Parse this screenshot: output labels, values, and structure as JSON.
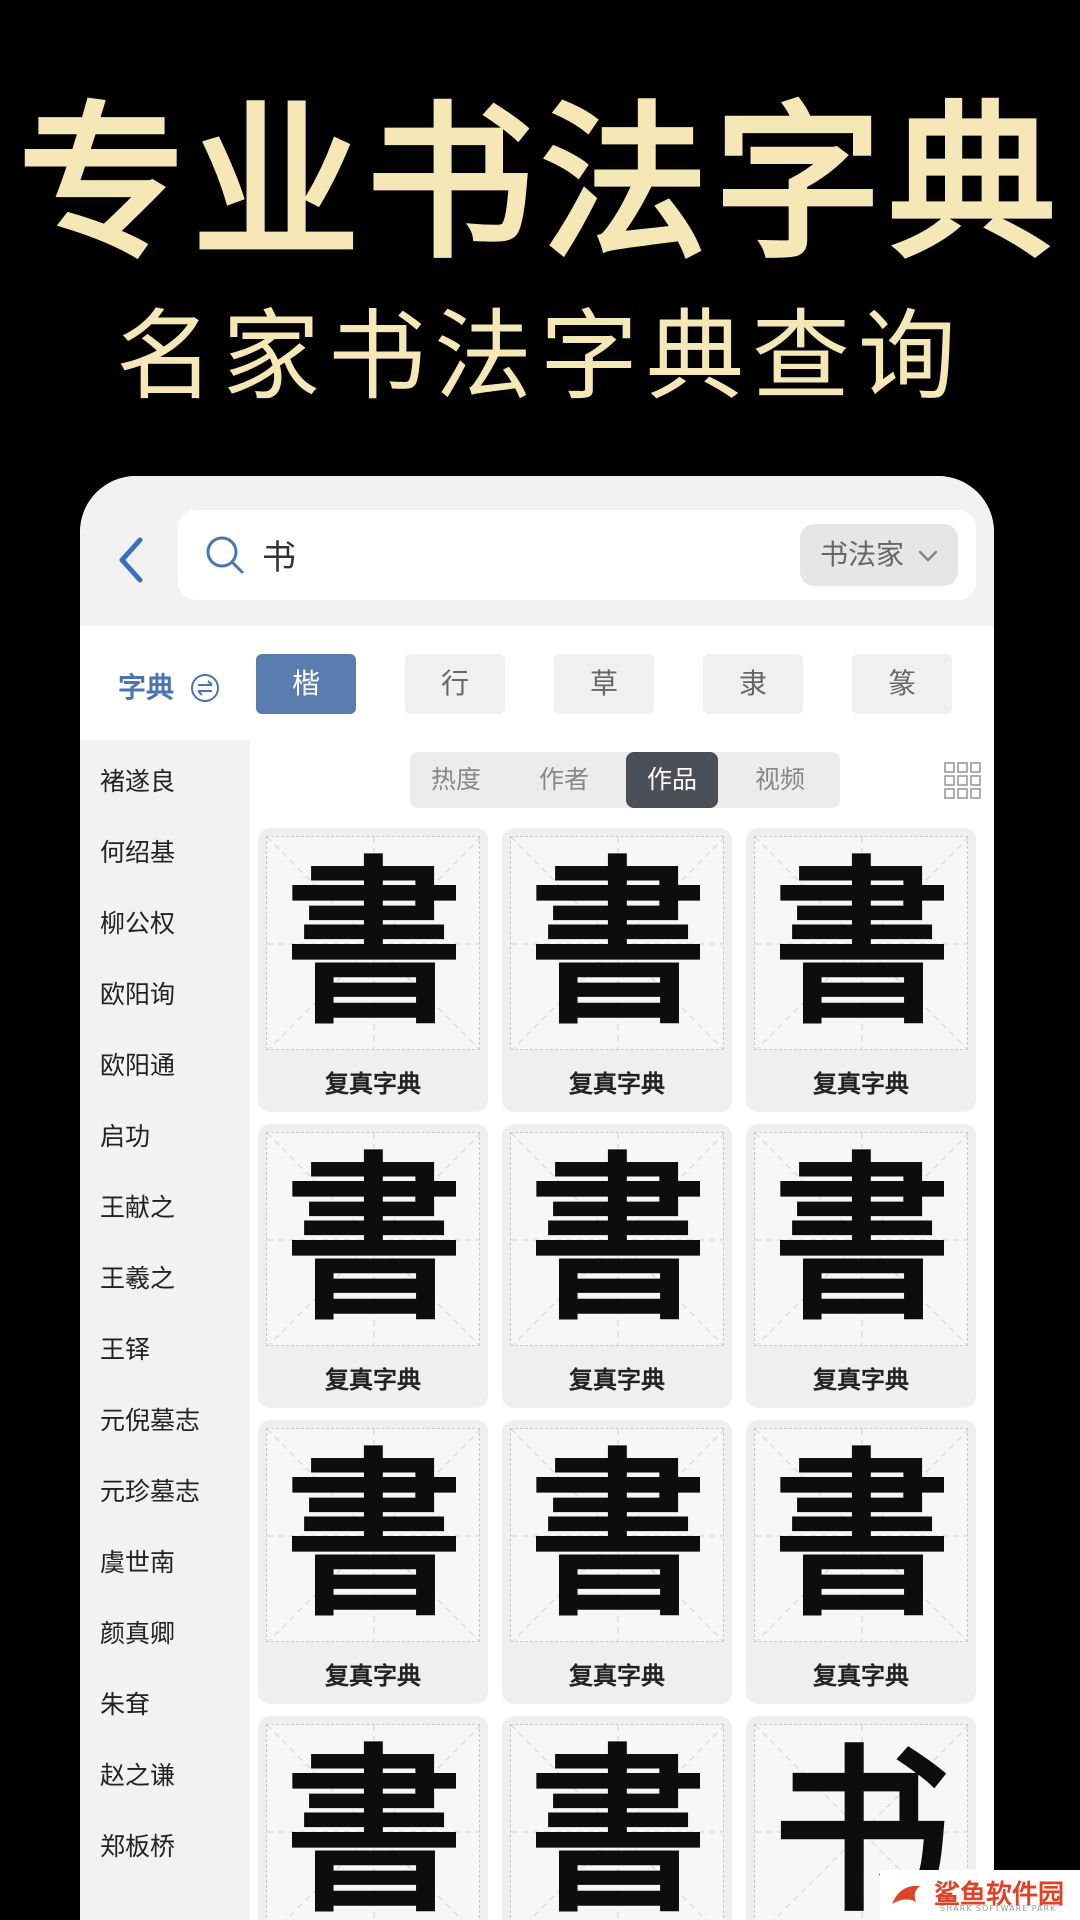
{
  "promo": {
    "title": "专业书法字典",
    "subtitle": "名家书法字典查询"
  },
  "search": {
    "query": "书",
    "filter_label": "书法家"
  },
  "dict_toggle": "字典",
  "script_tabs": [
    "楷",
    "行",
    "草",
    "隶",
    "篆"
  ],
  "active_script": "楷",
  "calligraphers": [
    "褚遂良",
    "何绍基",
    "柳公权",
    "欧阳询",
    "欧阳通",
    "启功",
    "王献之",
    "王羲之",
    "王铎",
    "元倪墓志",
    "元珍墓志",
    "虞世南",
    "颜真卿",
    "朱耷",
    "赵之谦",
    "郑板桥"
  ],
  "sort_tabs": [
    "热度",
    "作者",
    "作品",
    "视频"
  ],
  "active_sort": "作品",
  "cards": [
    {
      "glyph": "書",
      "caption": "复真字典"
    },
    {
      "glyph": "書",
      "caption": "复真字典"
    },
    {
      "glyph": "書",
      "caption": "复真字典"
    },
    {
      "glyph": "書",
      "caption": "复真字典"
    },
    {
      "glyph": "書",
      "caption": "复真字典"
    },
    {
      "glyph": "書",
      "caption": "复真字典"
    },
    {
      "glyph": "書",
      "caption": "复真字典"
    },
    {
      "glyph": "書",
      "caption": "复真字典"
    },
    {
      "glyph": "書",
      "caption": "复真字典"
    },
    {
      "glyph": "書",
      "caption": ""
    },
    {
      "glyph": "書",
      "caption": ""
    },
    {
      "glyph": "书",
      "caption": ""
    }
  ],
  "watermark": {
    "name": "鲨鱼软件园",
    "tagline": "SHARK SOFTWARE PARK"
  },
  "colors": {
    "headline": "#f6e7b6",
    "accent": "#5a7daf",
    "segment_active": "#4b4f57"
  }
}
